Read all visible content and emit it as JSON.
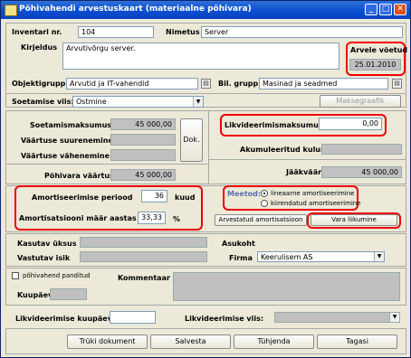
{
  "window": {
    "title": "Põhivahendi arvestuskaart (materiaalne põhivara)"
  },
  "fields": {
    "inventory_label": "Inventari nr.",
    "inventory_value": "104",
    "name_label": "Nimetus",
    "name_value": "Server",
    "description_label": "Kirjeldus",
    "description_value": "Arvutivõrgu server.",
    "accounting_date_label": "Arvele võetud",
    "accounting_date_value": "25.01.2010",
    "object_group_label": "Objektigrupp",
    "object_group_value": "Arvutid ja IT-vahendid",
    "bil_group_label": "Bil. grupp",
    "bil_group_value": "Masinad ja seadmed",
    "acquisition_method_label": "Soetamise viis:",
    "acquisition_method_value": "Ostmine",
    "payments_button": "Maksegraafik"
  },
  "costs": {
    "acquisition_cost_label": "Soetamismaksumus",
    "acquisition_cost_value": "45 000,00",
    "value_increase_label": "Väärtuse suurenemine",
    "value_decrease_label": "Väärtuse vähenemine",
    "doc_button": "Dok.",
    "asset_value_label": "Põhivara väärtus",
    "asset_value_value": "45 000,00",
    "liquidation_cost_label": "Likvideerimismaksumus",
    "liquidation_cost_value": "0,00",
    "accumulated_depreciation_label": "Akumuleeritud kulum",
    "residual_value_label": "Jääkväärtus",
    "residual_value_value": "45 000,00"
  },
  "depreciation": {
    "period_label": "Amortiseerimise periood",
    "period_value": "36",
    "period_unit": "kuud",
    "rate_label": "Amortisatsiooni määr aastas",
    "rate_value": "33,33",
    "rate_unit": "%",
    "method_label": "Meetod:",
    "method_linear": "lineaarne amortiseerimine",
    "method_accelerated": "kiirendatud amortiseerimine",
    "calc_button": "Arvestatud amortisatsioon",
    "movement_button": "Vara liikumine"
  },
  "location": {
    "user_unit_label": "Kasutav üksus",
    "responsible_label": "Vastutav isik",
    "address_label": "Asukoht",
    "company_label": "Firma",
    "company_value": "Keerulisem AS"
  },
  "pledge": {
    "pledged_label": "põhivahend panditud",
    "date_label": "Kuupäev",
    "comment_label": "Kommentaar"
  },
  "liquidation": {
    "date_label": "Likvideerimise kuupäev",
    "method_label": "Likvideerimise viis:"
  },
  "buttons": {
    "print": "Trüki dokument",
    "save": "Salvesta",
    "cancel": "Tühjenda",
    "back": "Tagasi"
  },
  "colors": {
    "highlight": "#e00000",
    "title_bar": "#0a4ed0",
    "window_bg": "#ece9d8"
  }
}
